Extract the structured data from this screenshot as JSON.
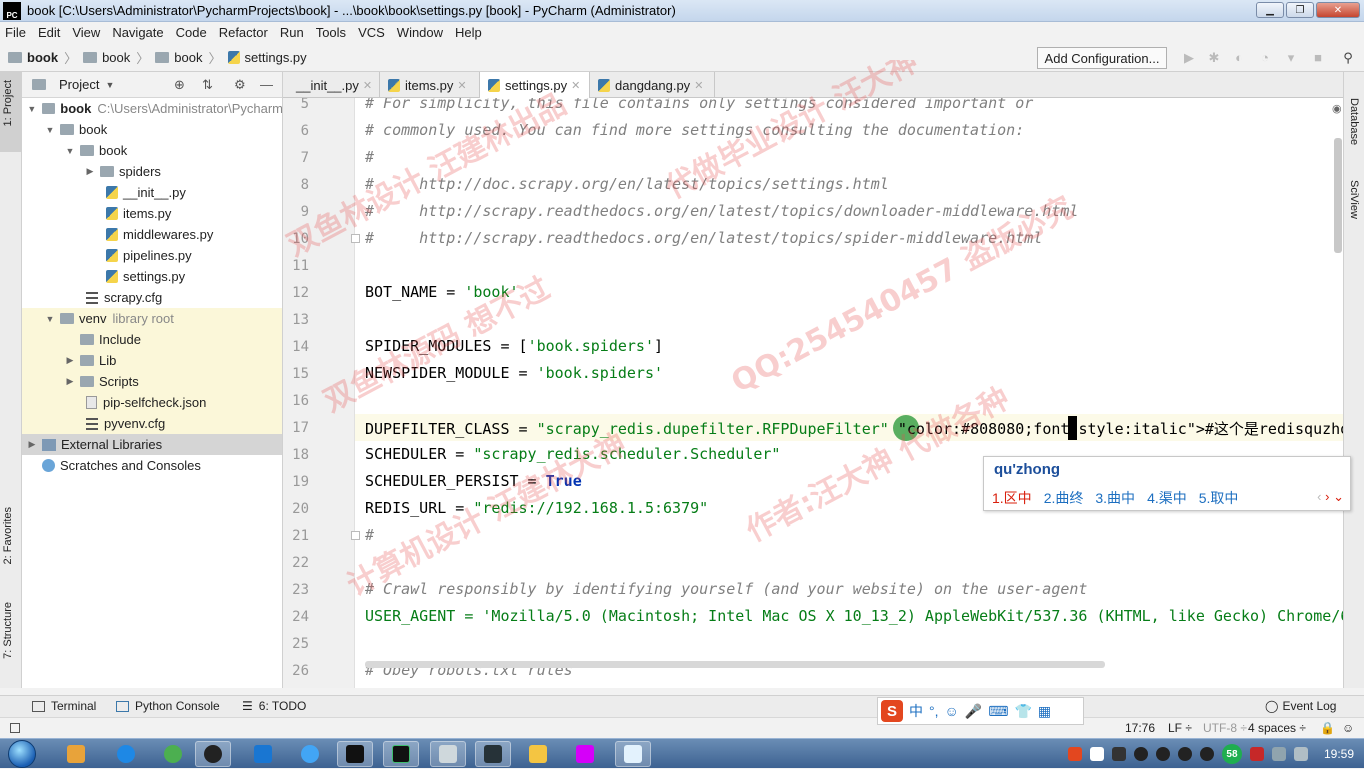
{
  "window": {
    "title": "book [C:\\Users\\Administrator\\PycharmProjects\\book] - ...\\book\\book\\settings.py [book] - PyCharm (Administrator)",
    "app_logo": "PC"
  },
  "menu": [
    "File",
    "Edit",
    "View",
    "Navigate",
    "Code",
    "Refactor",
    "Run",
    "Tools",
    "VCS",
    "Window",
    "Help"
  ],
  "breadcrumb": [
    "book",
    "book",
    "book",
    "settings.py"
  ],
  "toolbar": {
    "add_configuration": "Add Configuration..."
  },
  "side_tabs": {
    "project": "1: Project",
    "favorites": "2: Favorites",
    "structure": "7: Structure",
    "database": "Database",
    "sciview": "SciView"
  },
  "project_pane": {
    "header": "Project",
    "tree": [
      {
        "label": "book",
        "extra": "C:\\Users\\Administrator\\Pycharm",
        "bold": true
      },
      {
        "label": "book"
      },
      {
        "label": "book"
      },
      {
        "label": "spiders"
      },
      {
        "label": "__init__.py"
      },
      {
        "label": "items.py"
      },
      {
        "label": "middlewares.py"
      },
      {
        "label": "pipelines.py"
      },
      {
        "label": "settings.py"
      },
      {
        "label": "scrapy.cfg"
      },
      {
        "label": "venv",
        "extra": "library root"
      },
      {
        "label": "Include"
      },
      {
        "label": "Lib"
      },
      {
        "label": "Scripts"
      },
      {
        "label": "pip-selfcheck.json"
      },
      {
        "label": "pyvenv.cfg"
      },
      {
        "label": "External Libraries"
      },
      {
        "label": "Scratches and Consoles"
      }
    ]
  },
  "tabs": [
    "__init__.py",
    "items.py",
    "settings.py",
    "dangdang.py"
  ],
  "active_tab": "settings.py",
  "editor": {
    "lines": [
      {
        "n": "5",
        "text": "# For simplicity, this file contains only settings considered important or"
      },
      {
        "n": "6",
        "text": "# commonly used. You can find more settings consulting the documentation:"
      },
      {
        "n": "7",
        "text": "#"
      },
      {
        "n": "8",
        "text": "#     http://doc.scrapy.org/en/latest/topics/settings.html"
      },
      {
        "n": "9",
        "text": "#     http://scrapy.readthedocs.org/en/latest/topics/downloader-middleware.html"
      },
      {
        "n": "10",
        "text": "#     http://scrapy.readthedocs.org/en/latest/topics/spider-middleware.html"
      },
      {
        "n": "11",
        "text": ""
      },
      {
        "n": "12",
        "text": "BOT_NAME = 'book'"
      },
      {
        "n": "13",
        "text": ""
      },
      {
        "n": "14",
        "text": "SPIDER_MODULES = ['book.spiders']"
      },
      {
        "n": "15",
        "text": "NEWSPIDER_MODULE = 'book.spiders'"
      },
      {
        "n": "16",
        "text": ""
      },
      {
        "n": "17",
        "text": "DUPEFILTER_CLASS = \"scrapy_redis.dupefilter.RFPDupeFilter\" #这个是redisquzhong"
      },
      {
        "n": "18",
        "text": "SCHEDULER = \"scrapy_redis.scheduler.Scheduler\""
      },
      {
        "n": "19",
        "text": "SCHEDULER_PERSIST = True"
      },
      {
        "n": "20",
        "text": "REDIS_URL = \"redis://192.168.1.5:6379\""
      },
      {
        "n": "21",
        "text": "#"
      },
      {
        "n": "22",
        "text": ""
      },
      {
        "n": "23",
        "text": "# Crawl responsibly by identifying yourself (and your website) on the user-agent"
      },
      {
        "n": "24",
        "text": "USER_AGENT = 'Mozilla/5.0 (Macintosh; Intel Mac OS X 10_13_2) AppleWebKit/537.36 (KHTML, like Gecko) Chrome/6"
      },
      {
        "n": "25",
        "text": ""
      },
      {
        "n": "26",
        "text": "# Obey robots.txt rules"
      }
    ]
  },
  "ime": {
    "pinyin": "qu'zhong",
    "candidates": [
      "1.区中",
      "2.曲终",
      "3.曲中",
      "4.渠中",
      "5.取中"
    ],
    "toolbar": [
      "中",
      "°,",
      "☺",
      "🎤",
      "⌨",
      "👕",
      "▦"
    ]
  },
  "bottom_tabs": [
    "Terminal",
    "Python Console",
    "6: TODO"
  ],
  "event_log": "Event Log",
  "status": {
    "position": "17:76",
    "line_sep": "LF ÷",
    "encoding": "UTF-8 ÷",
    "indent": "4 spaces ÷"
  },
  "taskbar": {
    "clock": "19:59",
    "badge": "58"
  },
  "watermark": [
    "双鱼林设计 汪建林出品",
    "代做毕业设计 汪大神",
    "双鱼林源码 想不过",
    "QQ:254540457 盗版必究",
    "计算机设计 汪建林大神",
    "作者:汪大神 代做各种"
  ],
  "colors": {
    "comment": "#808080",
    "string": "#067d17",
    "keyword": "#0033b3",
    "caret_line": "#fcfae8",
    "ime_accent": "#1d6fc0"
  }
}
